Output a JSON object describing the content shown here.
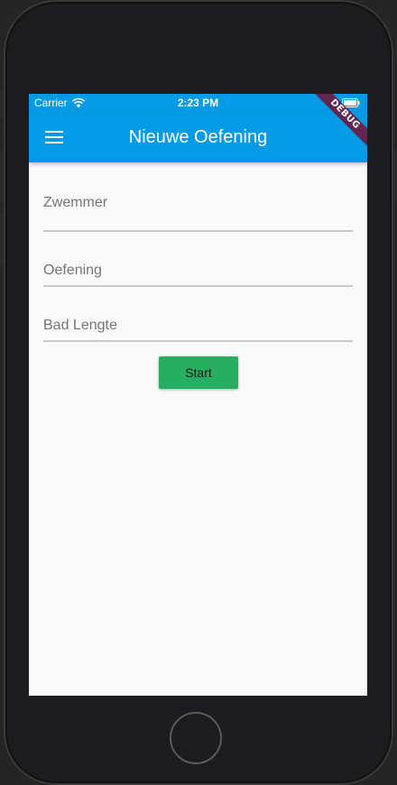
{
  "status_bar": {
    "carrier": "Carrier",
    "time": "2:23 PM"
  },
  "app_bar": {
    "title": "Nieuwe Oefening",
    "debug_label": "DEBUG"
  },
  "form": {
    "fields": [
      {
        "placeholder": "Zwemmer",
        "value": ""
      },
      {
        "placeholder": "Oefening",
        "value": ""
      },
      {
        "placeholder": "Bad Lengte",
        "value": ""
      }
    ],
    "start_label": "Start"
  },
  "colors": {
    "primary": "#039be5",
    "button": "#27ae60",
    "background": "#fafafa"
  },
  "icons": {
    "menu": "hamburger-menu-icon",
    "wifi": "wifi-icon",
    "battery": "battery-icon"
  }
}
